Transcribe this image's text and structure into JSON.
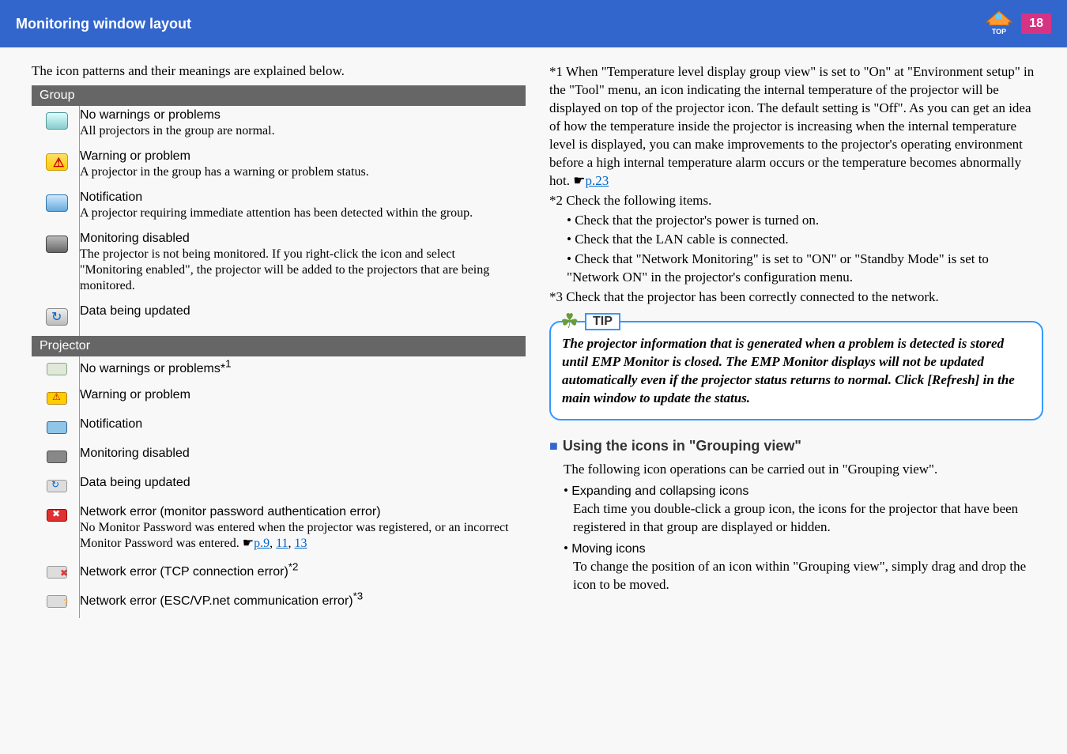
{
  "header": {
    "title": "Monitoring window layout",
    "page": "18"
  },
  "intro": "The icon patterns and their meanings are explained below.",
  "sections": {
    "group": "Group",
    "projector": "Projector"
  },
  "group": {
    "r0": {
      "t": "No warnings or problems",
      "d": "All projectors in the group are normal."
    },
    "r1": {
      "t": "Warning or problem",
      "d": "A projector in the group has a warning or problem status."
    },
    "r2": {
      "t": "Notification",
      "d": "A projector requiring immediate attention has been detected within the group."
    },
    "r3": {
      "t": "Monitoring disabled",
      "d": "The projector is not being monitored. If you right-click the icon and select \"Monitoring enabled\", the projector will be added to the projectors that are being monitored."
    },
    "r4": {
      "t": "Data being updated"
    }
  },
  "proj": {
    "r0": {
      "t": "No warnings or problems*",
      "sup": "1"
    },
    "r1": {
      "t": "Warning or problem"
    },
    "r2": {
      "t": "Notification"
    },
    "r3": {
      "t": "Monitoring disabled"
    },
    "r4": {
      "t": "Data being updated"
    },
    "r5": {
      "t": "Network error (monitor password authentication error)",
      "d1": "No Monitor Password was entered when the projector was registered, or an incorrect Monitor Password was entered. ",
      "link1": "p.9",
      "link2": "11",
      "link3": "13"
    },
    "r6": {
      "t": "Network error (TCP connection error)",
      "sup": "*2"
    },
    "r7": {
      "t": "Network error (ESC/VP.net communication error)",
      "sup": "*3"
    }
  },
  "fn": {
    "f1a": "*1 When \"Temperature level display group view\" is set to \"On\" at \"Environment setup\" in the \"Tool\" menu, an icon indicating the internal temperature of the projector will be displayed on top of the projector icon. The default setting is \"Off\". As you can get an idea of how the temperature inside the projector is increasing when the internal temperature level is displayed, you can make improvements to the projector's operating environment before a high internal temperature alarm occurs or the temperature becomes abnormally hot. ",
    "f1link": "p.23",
    "f2": "*2 Check the following items.",
    "f2a": "• Check that the projector's power is turned on.",
    "f2b": "• Check that the LAN cable is connected.",
    "f2c": "• Check that \"Network Monitoring\" is set to \"ON\" or \"Standby Mode\" is set to \"Network ON\" in the projector's configuration menu.",
    "f3": "*3 Check that the projector has been correctly connected to the network."
  },
  "tip": {
    "label": "TIP",
    "text": "The projector information that is generated when a problem is detected is stored until EMP Monitor is closed. The EMP Monitor displays will not be updated automatically even if the projector status returns to normal. Click [Refresh] in the main window to update the status."
  },
  "sub": {
    "heading": "Using the icons in \"Grouping view\"",
    "intro": "The following icon operations can be carried out in \"Grouping view\".",
    "b1t": "Expanding and collapsing icons",
    "b1d": "Each time you double-click a group icon, the icons for the projector that have been registered in that group are displayed or hidden.",
    "b2t": "Moving icons",
    "b2d": "To change the position of an icon within \"Grouping view\", simply drag and drop the icon to be moved."
  }
}
